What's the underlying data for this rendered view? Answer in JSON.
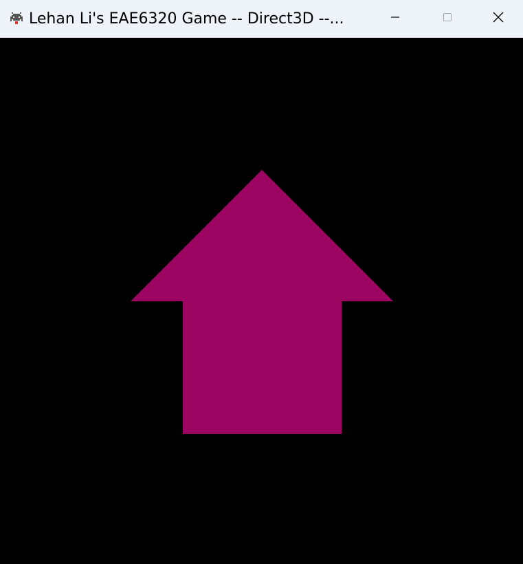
{
  "window": {
    "title": "Lehan Li's EAE6320 Game -- Direct3D --...",
    "controls": {
      "minimize": "minimize-icon",
      "maximize": "maximize-icon",
      "close": "close-icon"
    },
    "app_icon": "space-invader-icon"
  },
  "scene": {
    "background_color": "#000000",
    "shape": "up-arrow",
    "shape_color": "#9c0562"
  }
}
